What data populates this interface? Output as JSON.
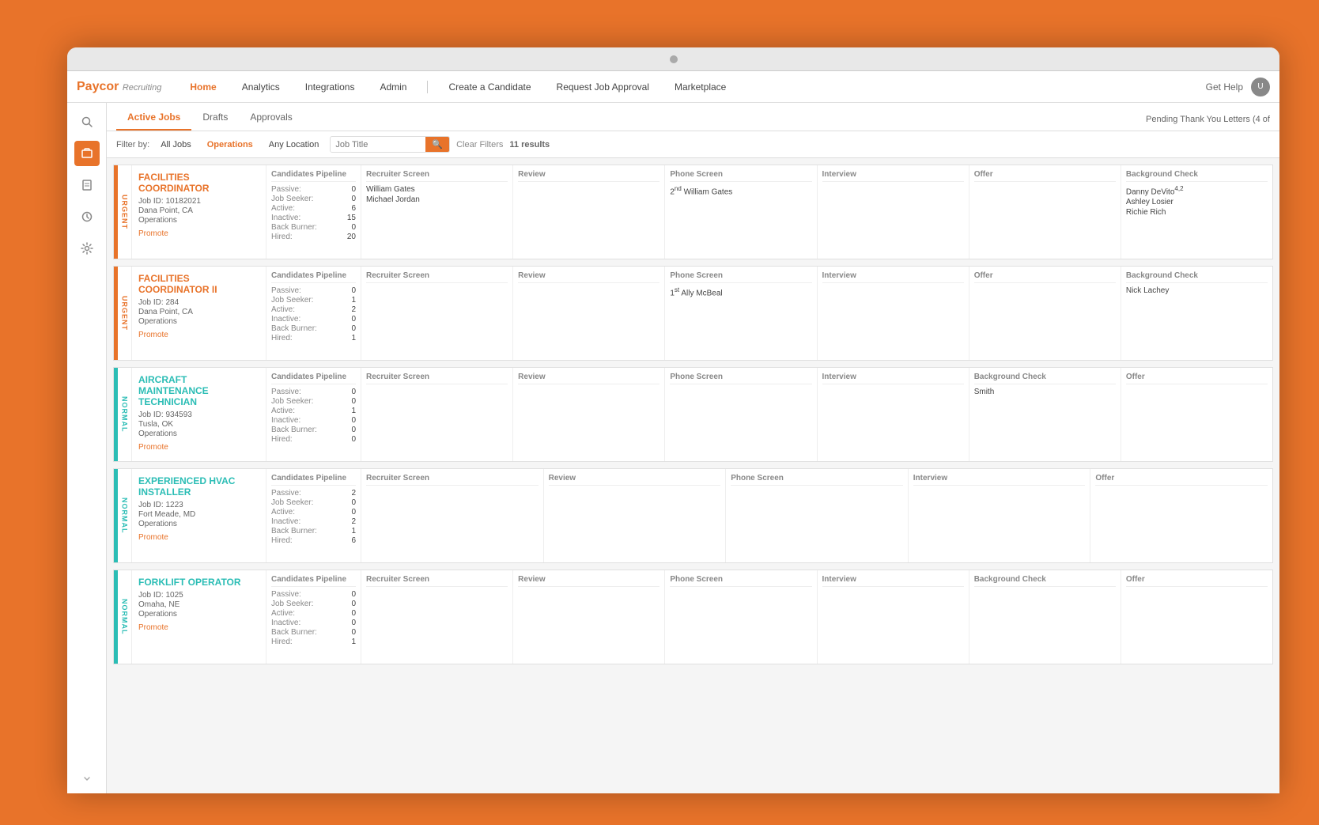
{
  "app": {
    "title": "Paycor",
    "subtitle": "Recruiting"
  },
  "nav": {
    "links": [
      {
        "label": "Home",
        "active": true
      },
      {
        "label": "Analytics",
        "active": false
      },
      {
        "label": "Integrations",
        "active": false
      },
      {
        "label": "Admin",
        "active": false
      },
      {
        "label": "Create a Candidate",
        "active": false
      },
      {
        "label": "Request Job Approval",
        "active": false
      },
      {
        "label": "Marketplace",
        "active": false
      }
    ],
    "right": {
      "help": "Get Help"
    }
  },
  "tabs": [
    {
      "label": "Active Jobs",
      "active": true
    },
    {
      "label": "Drafts",
      "active": false
    },
    {
      "label": "Approvals",
      "active": false
    }
  ],
  "pending_notice": "Pending Thank You Letters (4 of",
  "filter": {
    "label": "Filter by:",
    "all_jobs": "All Jobs",
    "operations": "Operations",
    "any_location": "Any Location",
    "placeholder": "Job Title",
    "clear": "Clear Filters",
    "results": "11 results"
  },
  "pipeline_headers": {
    "candidates": "Candidates Pipeline",
    "recruiter": "Recruiter Screen",
    "review": "Review",
    "phone": "Phone Screen",
    "interview": "Interview",
    "offer": "Offer",
    "background": "Background Check"
  },
  "stat_labels": {
    "passive": "Passive:",
    "job_seeker": "Job Seeker:",
    "active": "Active:",
    "inactive": "Inactive:",
    "back_burner": "Back Burner:",
    "hired": "Hired:"
  },
  "jobs": [
    {
      "id": "job1",
      "title": "FACILITIES COORDINATOR",
      "job_id": "Job ID: 10182021",
      "location": "Dana Point, CA",
      "department": "Operations",
      "urgency": "URGENT",
      "promote": "Promote",
      "border_color": "orange",
      "stats": {
        "passive": 0,
        "job_seeker": 0,
        "active": 6,
        "inactive": 15,
        "back_burner": 0,
        "hired": 20
      },
      "recruiter_screen": [
        "William Gates",
        "Michael Jordan"
      ],
      "review": [],
      "phone_screen": [
        "2nd William Gates"
      ],
      "interview": [],
      "offer": [],
      "background_check": [
        "Danny DeVito 4,2",
        "Ashley Losier",
        "Richie Rich"
      ]
    },
    {
      "id": "job2",
      "title": "FACILITIES COORDINATOR II",
      "job_id": "Job ID: 284",
      "location": "Dana Point, CA",
      "department": "Operations",
      "urgency": "URGENT",
      "promote": "Promote",
      "border_color": "orange",
      "stats": {
        "passive": 0,
        "job_seeker": 1,
        "active": 2,
        "inactive": 0,
        "back_burner": 0,
        "hired": 1
      },
      "recruiter_screen": [],
      "review": [],
      "phone_screen": [
        "1st Ally McBeal"
      ],
      "interview": [],
      "offer": [],
      "background_check": [
        "Nick Lachey"
      ]
    },
    {
      "id": "job3",
      "title": "AIRCRAFT MAINTENANCE TECHNICIAN",
      "job_id": "Job ID: 934593",
      "location": "Tusla, OK",
      "department": "Operations",
      "urgency": "NORMAL",
      "promote": "Promote",
      "border_color": "teal",
      "stats": {
        "passive": 0,
        "job_seeker": 0,
        "active": 1,
        "inactive": 0,
        "back_burner": 0,
        "hired": 0
      },
      "recruiter_screen": [],
      "review": [],
      "phone_screen": [],
      "interview": [],
      "background_check": [
        "Smith"
      ],
      "offer": []
    },
    {
      "id": "job4",
      "title": "EXPERIENCED HVAC INSTALLER",
      "job_id": "Job ID: 1223",
      "location": "Fort Meade, MD",
      "department": "Operations",
      "urgency": "NORMAL",
      "promote": "Promote",
      "border_color": "teal",
      "stats": {
        "passive": 2,
        "job_seeker": 0,
        "active": 0,
        "inactive": 2,
        "back_burner": 1,
        "hired": 6
      },
      "recruiter_screen": [],
      "review": [],
      "phone_screen": [],
      "interview": [],
      "offer": [],
      "background_check": []
    },
    {
      "id": "job5",
      "title": "FORKLIFT OPERATOR",
      "job_id": "Job ID: 1025",
      "location": "Omaha, NE",
      "department": "Operations",
      "urgency": "NORMAL",
      "promote": "Promote",
      "border_color": "teal",
      "stats": {
        "passive": 0,
        "job_seeker": 0,
        "active": 0,
        "inactive": 0,
        "back_burner": 0,
        "hired": 1
      },
      "recruiter_screen": [],
      "review": [],
      "phone_screen": [],
      "interview": [],
      "offer": [],
      "background_check": []
    }
  ]
}
